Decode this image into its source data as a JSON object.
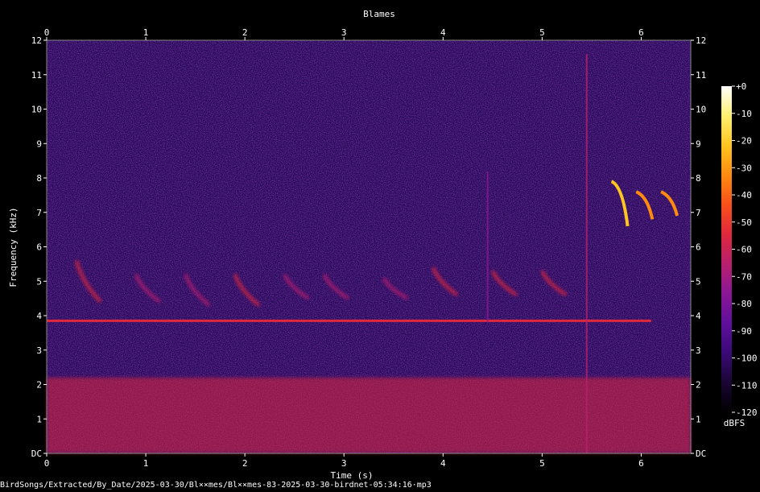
{
  "chart_data": {
    "type": "heatmap",
    "title": "Blames",
    "xlabel": "Time (s)",
    "ylabel": "Frequency (kHz)",
    "xlim": [
      0,
      6.5
    ],
    "ylim": [
      0,
      12
    ],
    "x_ticks": [
      "0",
      "1",
      "2",
      "3",
      "4",
      "5",
      "6"
    ],
    "y_ticks": [
      "DC",
      "1",
      "2",
      "3",
      "4",
      "5",
      "6",
      "7",
      "8",
      "9",
      "10",
      "11",
      "12"
    ],
    "colorbar": {
      "label": "dBFS",
      "range": [
        -120,
        0
      ],
      "ticks": [
        "+0",
        "-10",
        "-20",
        "-30",
        "-40",
        "-50",
        "-60",
        "-70",
        "-80",
        "-90",
        "-100",
        "-110",
        "-120"
      ],
      "colors": [
        "#000000",
        "#1a0533",
        "#3a0a78",
        "#5f0f9a",
        "#8a1796",
        "#b81f6e",
        "#e0283c",
        "#f8501a",
        "#ff8a10",
        "#ffc520",
        "#fff070",
        "#ffffff"
      ]
    },
    "background_level_dbfs": -95,
    "low_freq_band": {
      "kHz": [
        0,
        2.2
      ],
      "dbfs": -60
    },
    "tone_line": {
      "kHz": 3.85,
      "t": [
        0,
        6.1
      ],
      "dbfs": -55
    },
    "calls": [
      {
        "t": 0.3,
        "kHz": [
          4.4,
          5.6
        ],
        "dbfs": -55
      },
      {
        "t": 0.9,
        "kHz": [
          4.4,
          5.2
        ],
        "dbfs": -65
      },
      {
        "t": 1.4,
        "kHz": [
          4.3,
          5.2
        ],
        "dbfs": -65
      },
      {
        "t": 1.9,
        "kHz": [
          4.3,
          5.2
        ],
        "dbfs": -60
      },
      {
        "t": 2.4,
        "kHz": [
          4.5,
          5.2
        ],
        "dbfs": -65
      },
      {
        "t": 2.8,
        "kHz": [
          4.5,
          5.2
        ],
        "dbfs": -65
      },
      {
        "t": 3.4,
        "kHz": [
          4.5,
          5.1
        ],
        "dbfs": -65
      },
      {
        "t": 3.9,
        "kHz": [
          4.6,
          5.4
        ],
        "dbfs": -60
      },
      {
        "t": 4.5,
        "kHz": [
          4.6,
          5.3
        ],
        "dbfs": -60
      },
      {
        "t": 5.0,
        "kHz": [
          4.6,
          5.3
        ],
        "dbfs": -60
      }
    ],
    "high_calls": [
      {
        "t": 5.7,
        "kHz": [
          6.6,
          7.9
        ],
        "dbfs": -25
      },
      {
        "t": 5.95,
        "kHz": [
          6.8,
          7.6
        ],
        "dbfs": -30
      },
      {
        "t": 6.2,
        "kHz": [
          6.9,
          7.6
        ],
        "dbfs": -30
      }
    ],
    "vertical_clicks": [
      {
        "t": 5.45,
        "kHz": [
          0,
          11.6
        ],
        "dbfs": -70
      },
      {
        "t": 4.45,
        "kHz": [
          3.8,
          8.2
        ],
        "dbfs": -75
      }
    ]
  },
  "footer_path": "BirdSongs/Extracted/By_Date/2025-03-30/Bl××mes/Bl××mes-83-2025-03-30-birdnet-05:34:16·mp3"
}
